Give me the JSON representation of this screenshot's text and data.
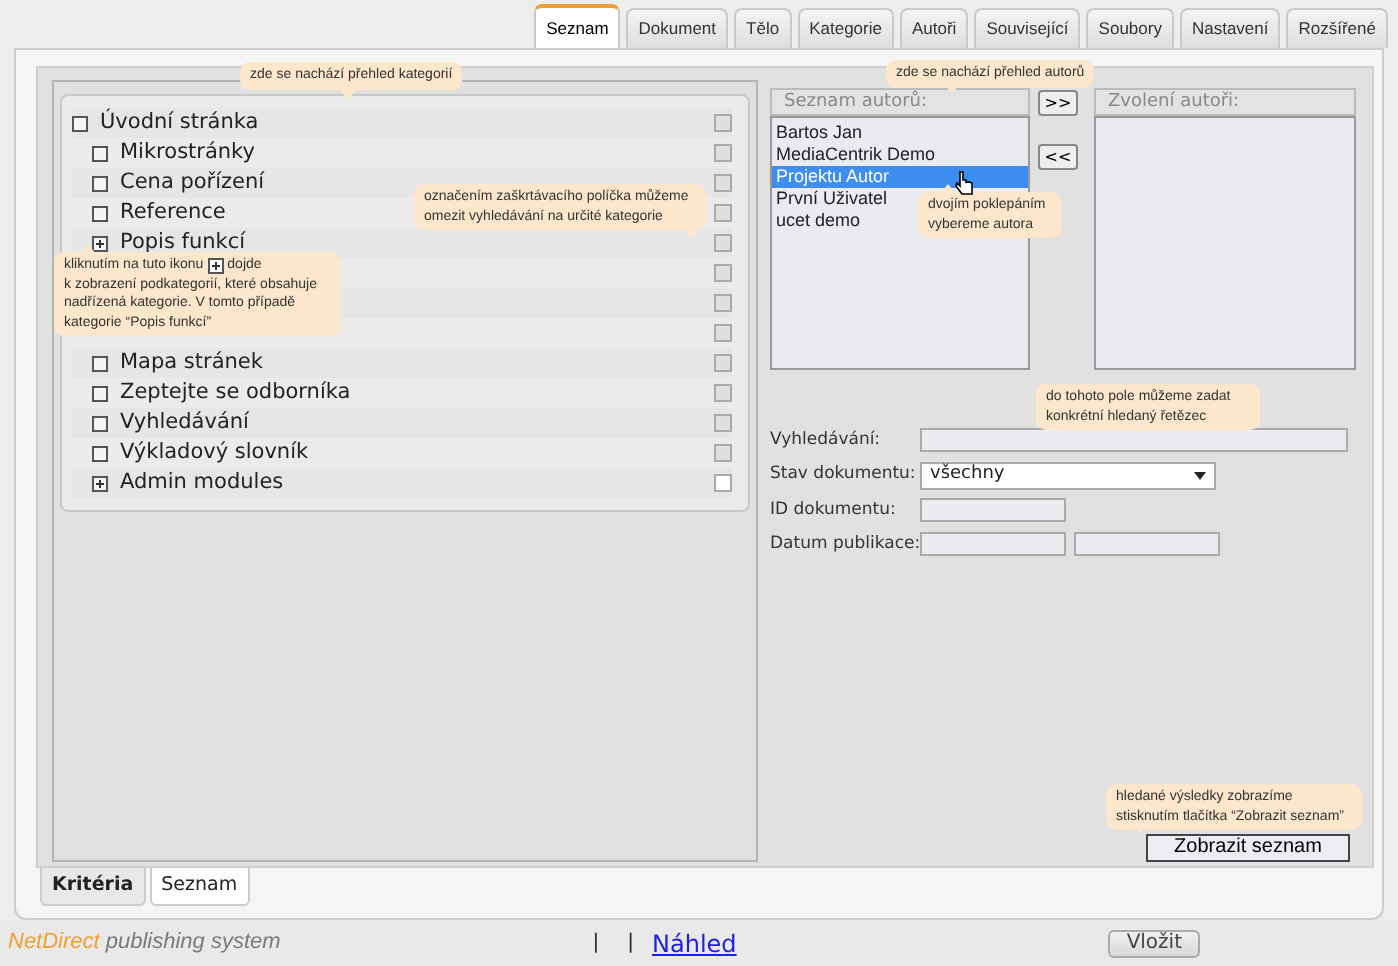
{
  "tabs": [
    {
      "label": "Seznam",
      "selected": true
    },
    {
      "label": "Dokument",
      "selected": false
    },
    {
      "label": "Tělo",
      "selected": false
    },
    {
      "label": "Kategorie",
      "selected": false
    },
    {
      "label": "Autoři",
      "selected": false
    },
    {
      "label": "Související",
      "selected": false
    },
    {
      "label": "Soubory",
      "selected": false
    },
    {
      "label": "Nastavení",
      "selected": false
    },
    {
      "label": "Rozšířené",
      "selected": false
    }
  ],
  "category_tree": [
    {
      "label": "Úvodní stránka",
      "kind": "leaf",
      "checked": false,
      "disabled": true,
      "children": [
        {
          "label": "Mikrostránky",
          "kind": "leaf",
          "checked": false,
          "disabled": true
        },
        {
          "label": "Cena pořízení",
          "kind": "leaf",
          "checked": false,
          "disabled": true
        },
        {
          "label": "Reference",
          "kind": "leaf",
          "checked": false,
          "disabled": true
        },
        {
          "label": "Popis funkcí",
          "kind": "collapsed",
          "checked": false,
          "disabled": true
        },
        {
          "checked": false,
          "disabled": true
        },
        {
          "checked": false,
          "disabled": true
        },
        {
          "checked": false,
          "disabled": true
        },
        {
          "label": "Mapa stránek",
          "kind": "leaf",
          "checked": false,
          "disabled": true
        },
        {
          "label": "Zeptejte se odborníka",
          "kind": "leaf",
          "checked": false,
          "disabled": true
        },
        {
          "label": "Vyhledávání",
          "kind": "leaf",
          "checked": false,
          "disabled": true
        },
        {
          "label": "Výkladový slovník",
          "kind": "leaf",
          "checked": false,
          "disabled": true
        },
        {
          "label": "Admin modules",
          "kind": "collapsed",
          "checked": false,
          "disabled": false
        }
      ]
    }
  ],
  "authors": {
    "list_title": "Seznam autorů:",
    "chosen_title": "Zvolení autoři:",
    "add_button": ">>",
    "remove_button": "<<",
    "items": [
      {
        "label": "Bartos Jan",
        "selected": false
      },
      {
        "label": "MediaCentrik Demo",
        "selected": false
      },
      {
        "label": "Projektu Autor",
        "selected": true
      },
      {
        "label": "První Uživatel",
        "selected": false
      },
      {
        "label": "ucet demo",
        "selected": false
      }
    ]
  },
  "form": {
    "search_label": "Vyhledávání:",
    "status_label": "Stav dokumentu:",
    "status_value": "všechny",
    "id_label": "ID dokumentu:",
    "date_label": "Datum publikace:"
  },
  "submit_button": "Zobrazit seznam",
  "bottom_tabs": [
    {
      "label": "Kritéria",
      "selected": true
    },
    {
      "label": "Seznam",
      "selected": false
    }
  ],
  "tooltips": {
    "categories": "zde se nachází přehled kategorií",
    "checkbox": "označením zaškrtávacího políčka můžeme omezit vyhledávání na určité kategorie",
    "expand_before": "kliknutím na tuto ikonu",
    "expand_after": "dojde",
    "expand_rest": "k zobrazení podkategorií, které obsahuje nadřízená kategorie. V tomto případě kategorie “Popis funkcí”",
    "authors": "zde se nachází přehled autorů",
    "double_click": "dvojím poklepáním vybereme autora",
    "search": "do tohoto pole můžeme zadat konkrétní hledaný řetězec",
    "results": "hledané výsledky zobrazíme stisknutím tlačítka “Zobrazit seznam”"
  },
  "footer": {
    "logo_brand": "NetDirect",
    "logo_rest": "publishing system",
    "separator_1": "|",
    "separator_2": "|",
    "preview_link": "Náhled",
    "insert_button": "Vložit"
  }
}
